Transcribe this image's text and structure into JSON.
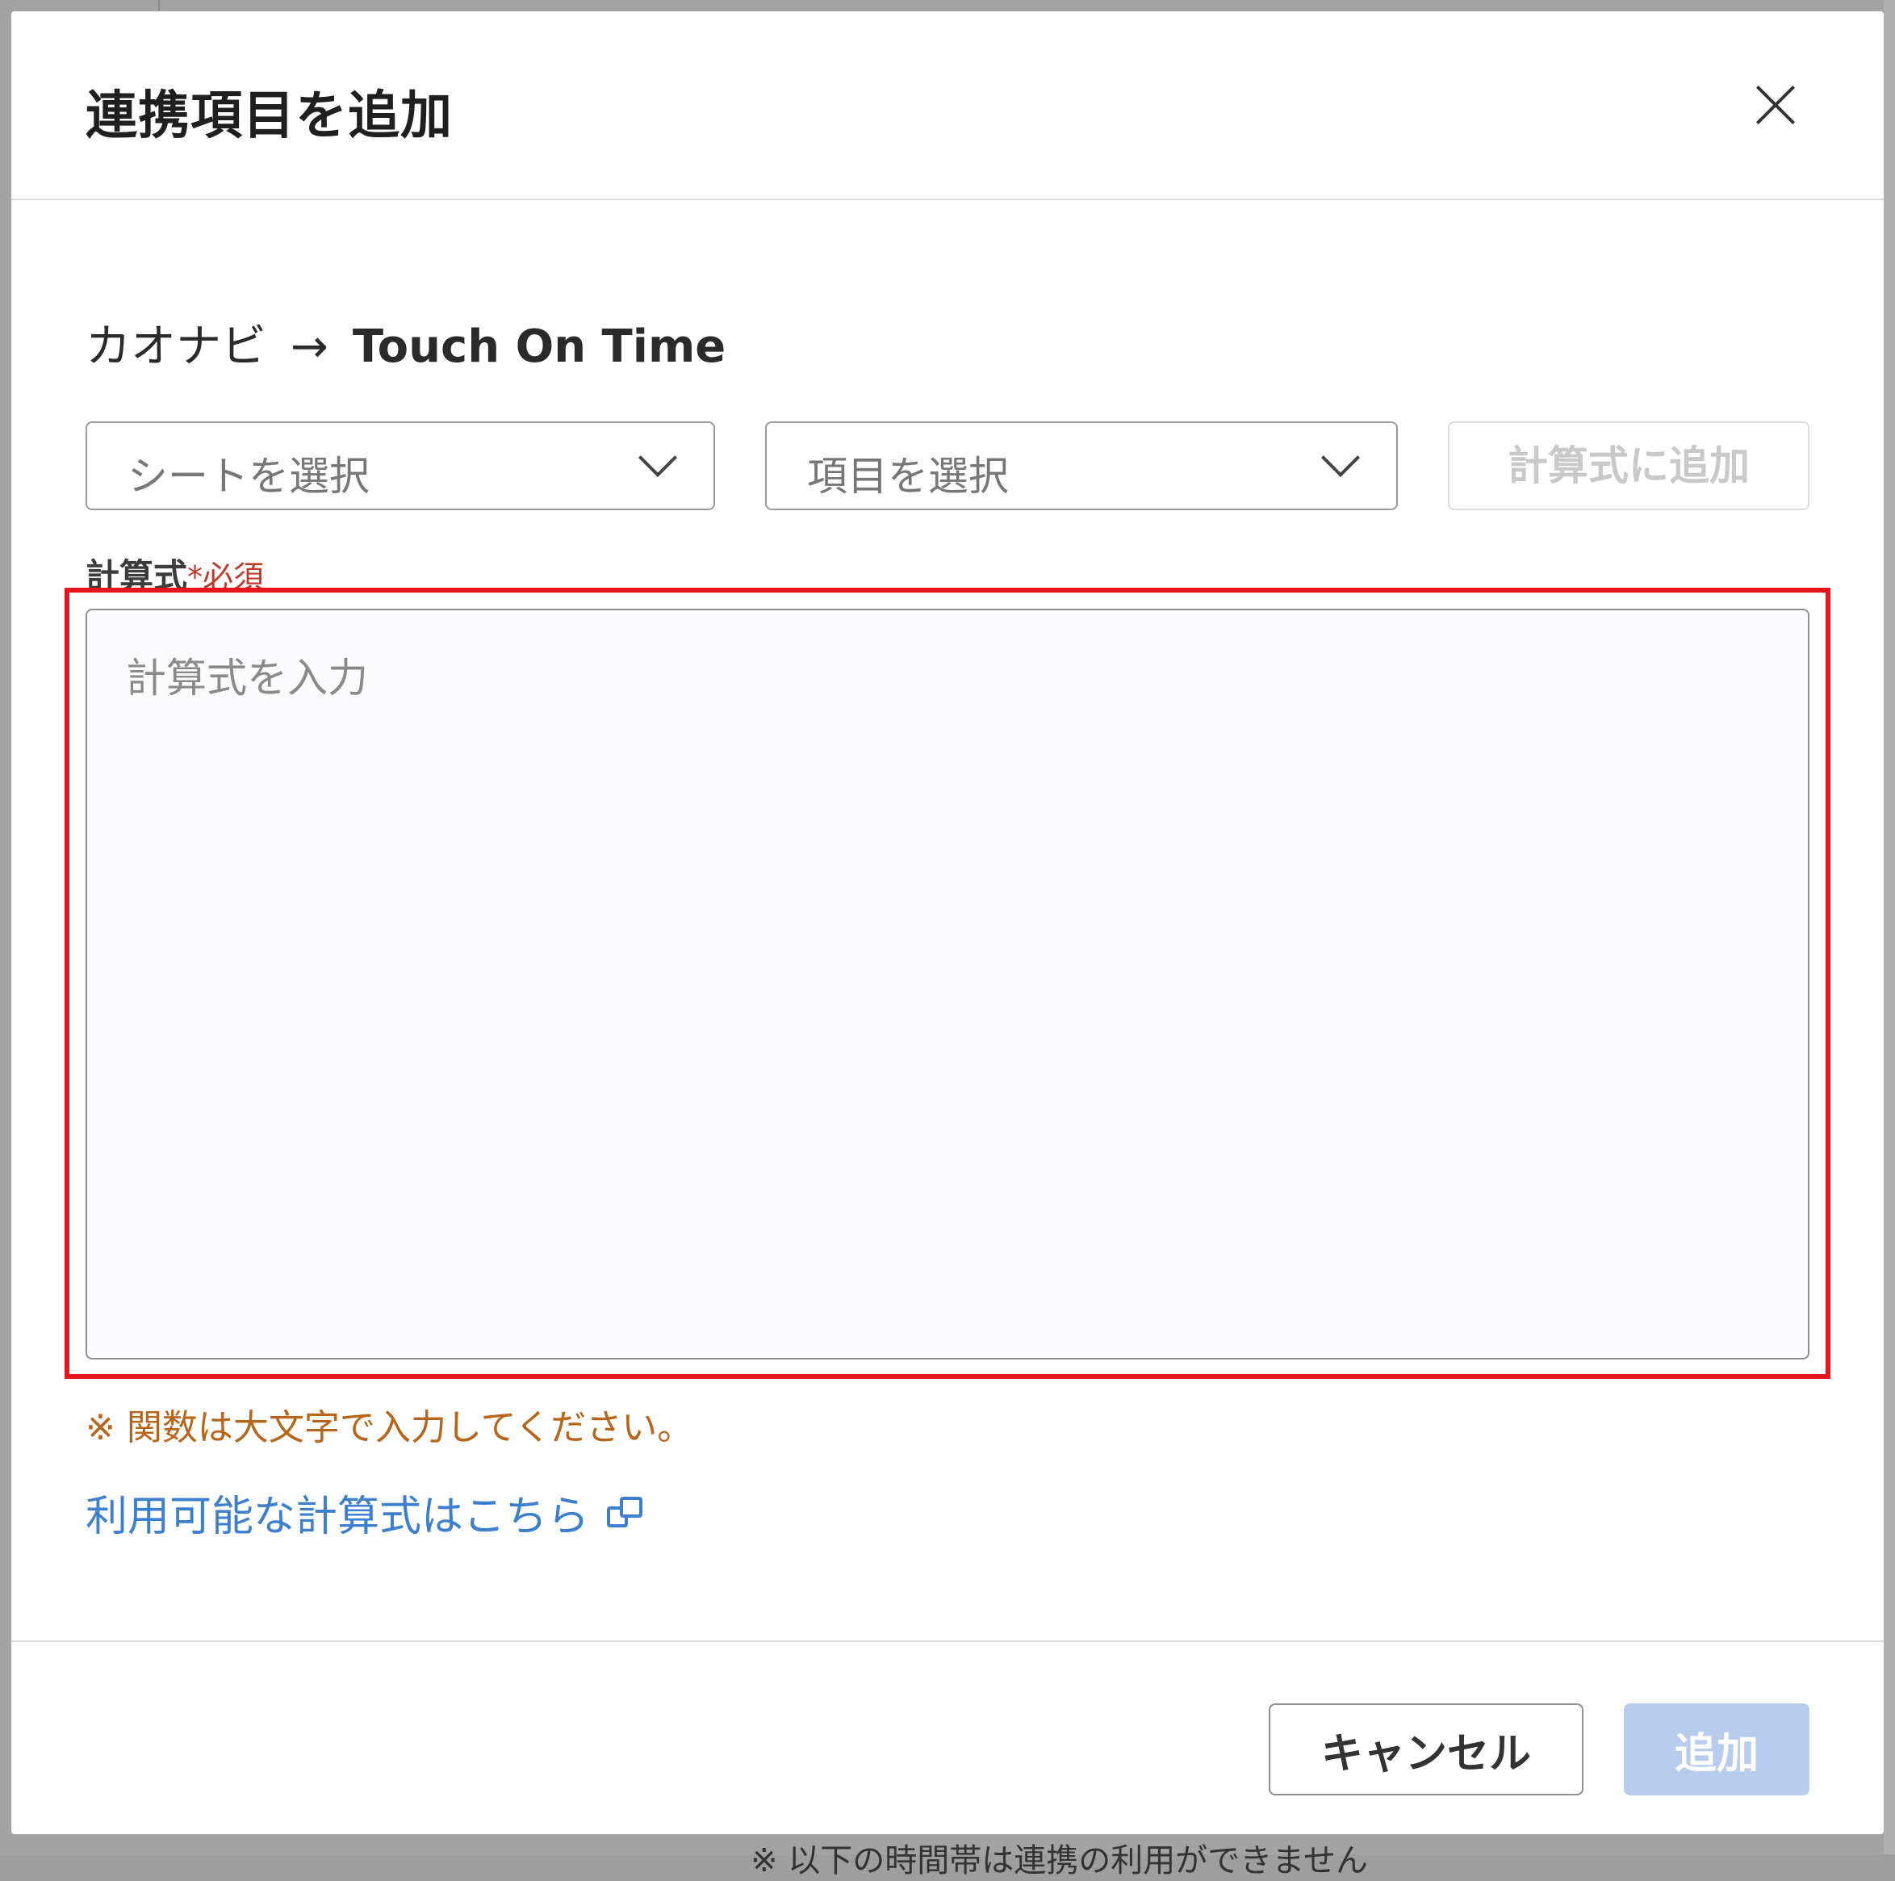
{
  "background": {
    "partial_text": "※ 以下の時間帯は連携の利用ができません"
  },
  "dialog": {
    "title": "連携項目を追加",
    "close_icon": "close-icon"
  },
  "flow": {
    "source": "カオナビ",
    "arrow": "→",
    "target": "Touch On Time"
  },
  "selectors": {
    "sheet_placeholder": "シートを選択",
    "item_placeholder": "項目を選択",
    "add_to_formula_label": "計算式に追加"
  },
  "formula": {
    "label": "計算式",
    "required_mark": "*",
    "required_text": "必須",
    "placeholder": "計算式を入力",
    "value": "",
    "note": "※ 関数は大文字で入力してください。",
    "help_link": "利用可能な計算式はこちら",
    "help_link_icon": "external-link-icon"
  },
  "footer": {
    "cancel_label": "キャンセル",
    "submit_label": "追加"
  },
  "colors": {
    "highlight": "#e8141b",
    "link": "#3d7fcf",
    "note": "#b8651a",
    "required": "#c0392b",
    "submit_disabled": "#b8cdee"
  }
}
